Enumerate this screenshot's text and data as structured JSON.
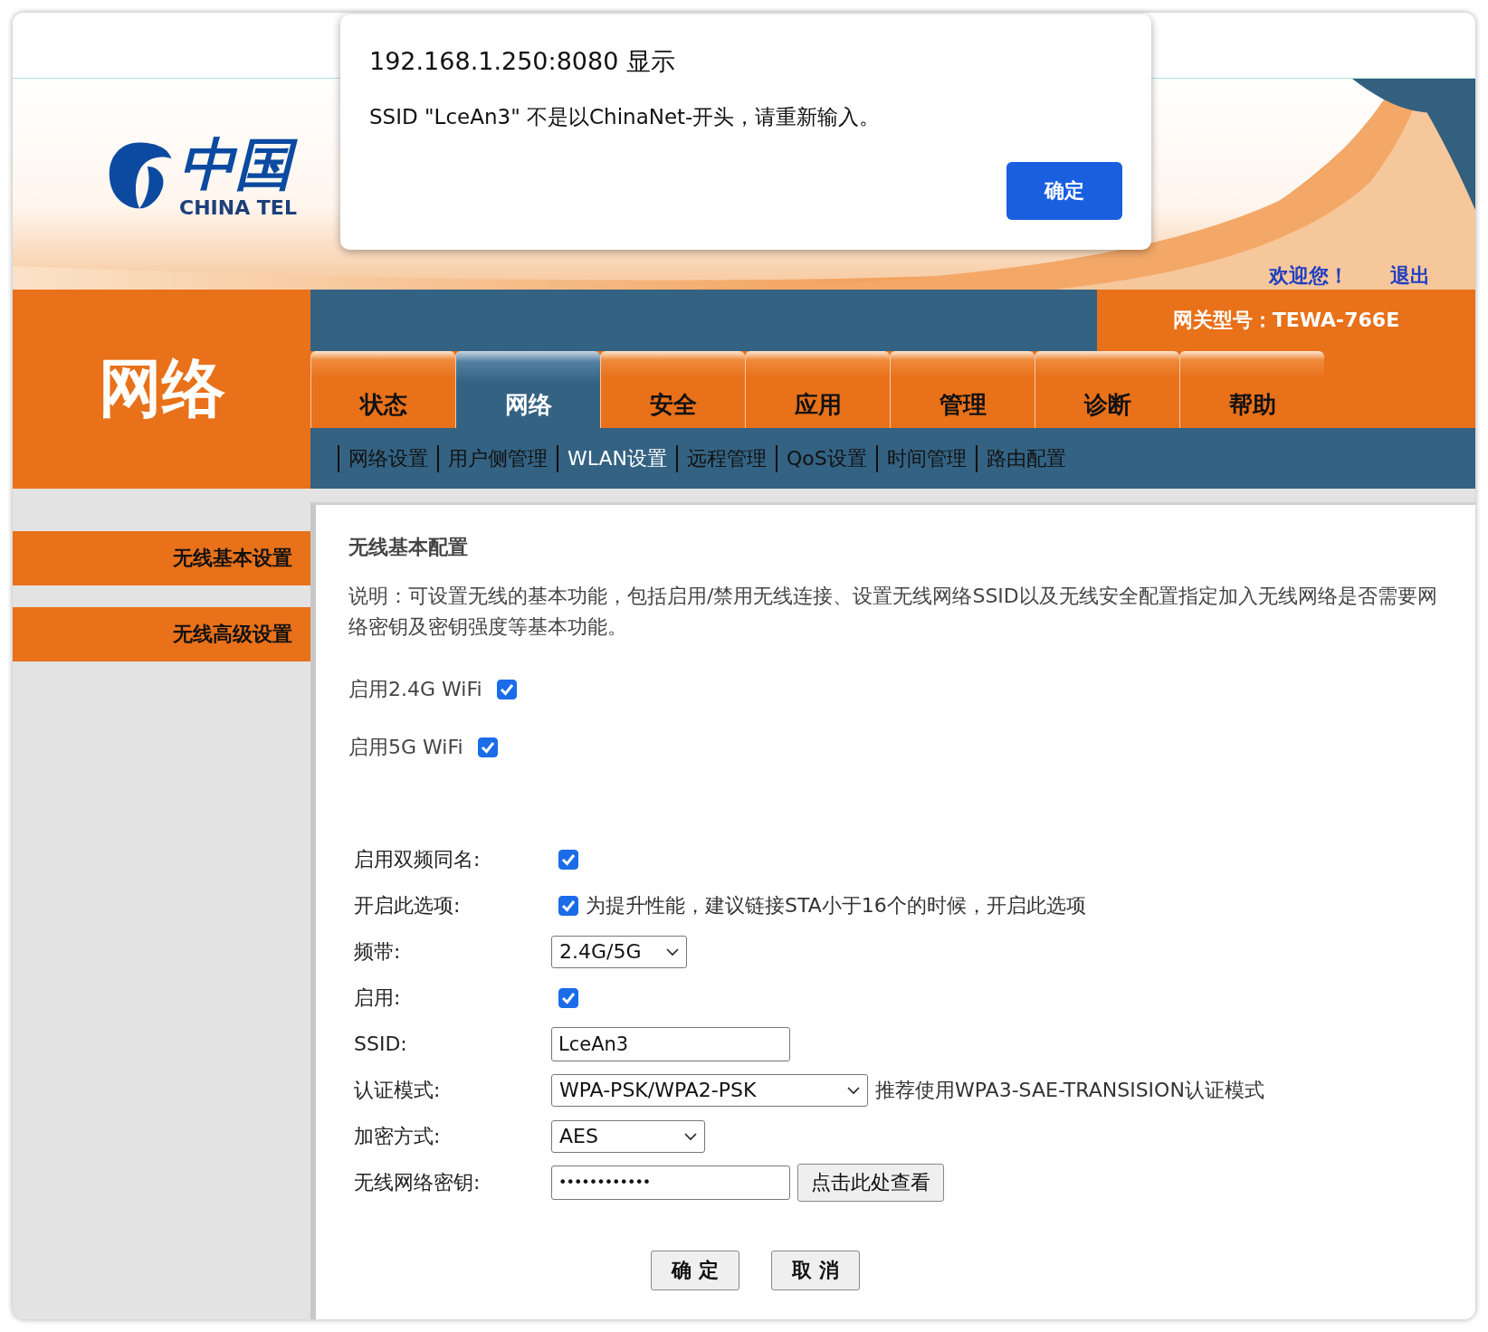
{
  "dialog": {
    "title": "192.168.1.250:8080 显示",
    "message": "SSID \"LceAn3\" 不是以ChinaNet-开头，请重新输入。",
    "button": "确定"
  },
  "header": {
    "logo_cn": "中国",
    "logo_en": "CHINA TEL",
    "welcome": "欢迎您！",
    "logout": "退出",
    "gateway_model": "网关型号：TEWA-766E"
  },
  "section_title": "网络",
  "tabs": [
    {
      "label": "状态",
      "selected": false
    },
    {
      "label": "网络",
      "selected": true
    },
    {
      "label": "安全",
      "selected": false
    },
    {
      "label": "应用",
      "selected": false
    },
    {
      "label": "管理",
      "selected": false
    },
    {
      "label": "诊断",
      "selected": false
    },
    {
      "label": "帮助",
      "selected": false
    }
  ],
  "subnav": [
    {
      "label": "网络设置",
      "selected": false
    },
    {
      "label": "用户侧管理",
      "selected": false
    },
    {
      "label": "WLAN设置",
      "selected": true
    },
    {
      "label": "远程管理",
      "selected": false
    },
    {
      "label": "QoS设置",
      "selected": false
    },
    {
      "label": "时间管理",
      "selected": false
    },
    {
      "label": "路由配置",
      "selected": false
    }
  ],
  "sidebar": [
    "无线基本设置",
    "无线高级设置"
  ],
  "content": {
    "title": "无线基本配置",
    "description": "说明：可设置无线的基本功能，包括启用/禁用无线连接、设置无线网络SSID以及无线安全配置指定加入无线网络是否需要网络密钥及密钥强度等基本功能。",
    "toggles": [
      {
        "label": "启用2.4G WiFi",
        "checked": true
      },
      {
        "label": "启用5G WiFi",
        "checked": true
      }
    ]
  },
  "form": [
    {
      "kind": "checkbox",
      "label": "启用双频同名:",
      "checked": true
    },
    {
      "kind": "checkbox",
      "label": "开启此选项:",
      "checked": true,
      "note": "为提升性能，建议链接STA小于16个的时候，开启此选项"
    },
    {
      "kind": "select",
      "label": "频带:",
      "value": "2.4G/5G"
    },
    {
      "kind": "checkbox",
      "label": "启用:",
      "checked": true
    },
    {
      "kind": "text",
      "label": "SSID:",
      "value": "LceAn3"
    },
    {
      "kind": "select",
      "label": "认证模式:",
      "value": "WPA-PSK/WPA2-PSK",
      "note": "推荐使用WPA3-SAE-TRANSISION认证模式"
    },
    {
      "kind": "select",
      "label": "加密方式:",
      "value": "AES"
    },
    {
      "kind": "password",
      "label": "无线网络密钥:",
      "value": "••••••••••••",
      "button": "点击此处查看"
    }
  ],
  "buttons": [
    "确 定",
    "取 消"
  ]
}
